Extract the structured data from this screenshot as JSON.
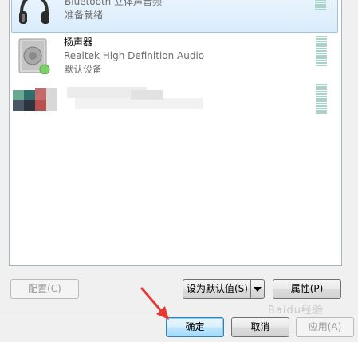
{
  "devices": [
    {
      "name": "",
      "description": "Bluetooth 立体声音频",
      "status": "准备就绪",
      "icon": "headphones-icon",
      "selected": true
    },
    {
      "name": "扬声器",
      "description": "Realtek High Definition Audio",
      "status": "默认设备",
      "icon": "speaker-icon",
      "selected": false
    }
  ],
  "buttons": {
    "configure": "配置(C)",
    "set_default": "设为默认值(S)",
    "properties": "属性(P)",
    "ok": "确定",
    "cancel": "取消",
    "apply": "应用(A)"
  },
  "watermark": "Baidu经验",
  "colors": {
    "list_border": "#aab4c0",
    "selection": "#d9ecfc",
    "level_meter": "#a9d3c9",
    "arrow": "#e53935"
  }
}
